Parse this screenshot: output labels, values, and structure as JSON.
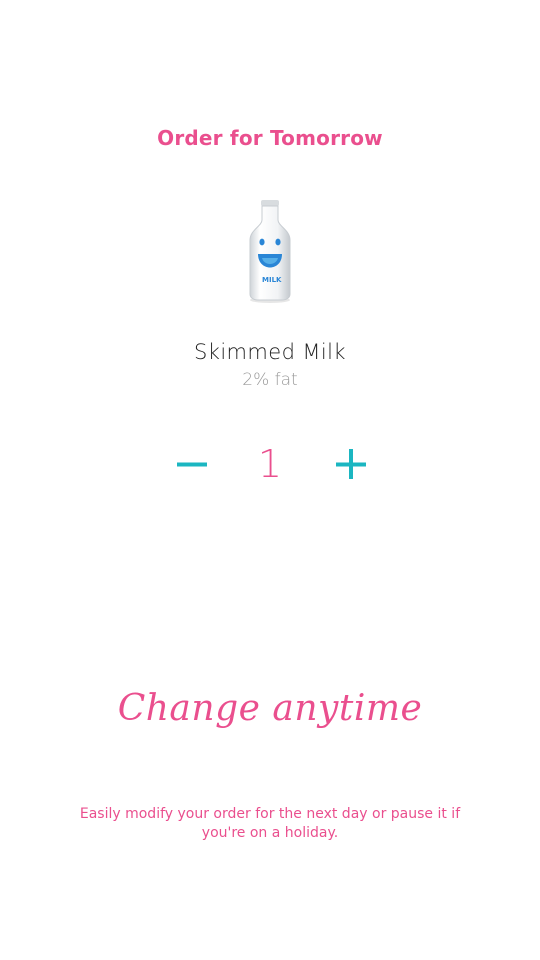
{
  "colors": {
    "accent_pink": "#ea4f8e",
    "accent_teal": "#1bb6c1",
    "text_dark": "#222222",
    "text_muted": "#9a9a9a"
  },
  "header": {
    "title": "Order for Tomorrow"
  },
  "product": {
    "image_icon": "milk-bottle-icon",
    "bottle_label": "MILK",
    "name": "Skimmed Milk",
    "detail": "2% fat"
  },
  "quantity": {
    "value": "1",
    "decrease_icon": "minus-icon",
    "increase_icon": "plus-icon"
  },
  "promo": {
    "tagline": "Change anytime",
    "description": "Easily modify your order for the next day or pause it if you're on a holiday."
  }
}
